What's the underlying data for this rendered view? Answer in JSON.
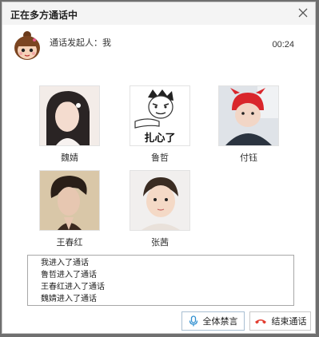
{
  "window": {
    "title": "正在多方通话中"
  },
  "header": {
    "initiator_label": "通话发起人：我",
    "timer": "00:24"
  },
  "members": [
    {
      "name": "魏婧"
    },
    {
      "name": "鲁哲",
      "photo_caption": "扎心了"
    },
    {
      "name": "付钰"
    },
    {
      "name": "王春红"
    },
    {
      "name": "张茜"
    }
  ],
  "log": [
    "我进入了通话",
    "鲁哲进入了通话",
    "王春红进入了通话",
    "魏婧进入了通话"
  ],
  "buttons": {
    "mute_all": "全体禁言",
    "end_call": "结束通话"
  },
  "colors": {
    "end_icon": "#e23b2e",
    "mic_icon": "#2f8fd0"
  }
}
